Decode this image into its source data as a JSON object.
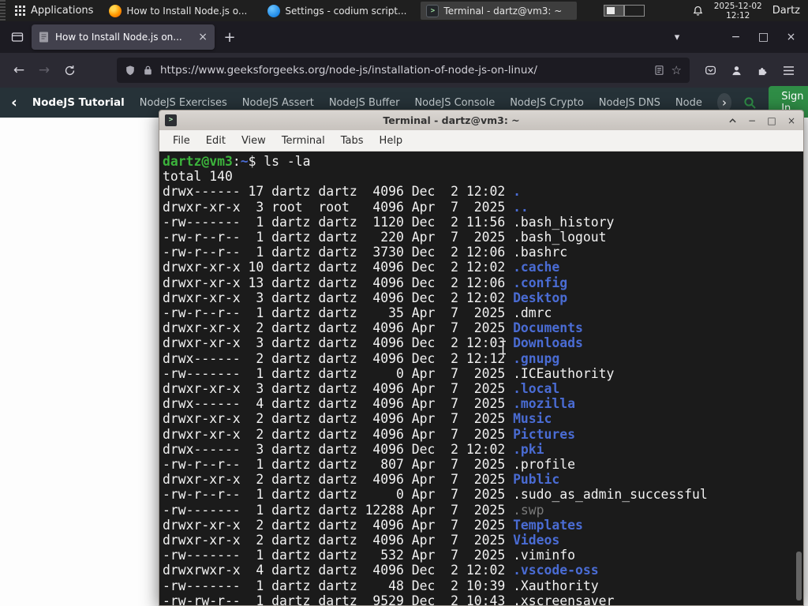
{
  "colors": {
    "prompt_green": "#3cb43c",
    "dir_blue": "#4a6cd4",
    "term_bg": "#1b1b1b",
    "term_fg": "#f2f2f2",
    "dim_file": "#7a7a7a",
    "gfg_green": "#2f8d46"
  },
  "panel": {
    "applications_label": "Applications",
    "tasks": [
      {
        "label": "How to Install Node.js o..."
      },
      {
        "label": "Settings - codium script..."
      },
      {
        "label": "Terminal - dartz@vm3: ~"
      }
    ],
    "date": "2025-12-02",
    "time": "12:12",
    "user": "Dartz"
  },
  "browser": {
    "tab_title": "How to Install Node.js on...",
    "url": "https://www.geeksforgeeks.org/node-js/installation-of-node-js-on-linux/",
    "site_nav": {
      "active_item": "NodeJS Tutorial",
      "items": [
        "NodeJS Exercises",
        "NodeJS Assert",
        "NodeJS Buffer",
        "NodeJS Console",
        "NodeJS Crypto",
        "NodeJS DNS",
        "Node"
      ],
      "sign_in_label": "Sign In"
    }
  },
  "glyphs": {
    "back": "←",
    "forward": "→",
    "new_tab": "+",
    "tab_close": "×",
    "minimize": "−",
    "maximize": "□",
    "close": "×",
    "chevron_down": "▾",
    "star": "☆",
    "prev_chevron": "‹",
    "next_chevron": "›",
    "prompt_gt": ">"
  },
  "terminal": {
    "window_title": "Terminal - dartz@vm3: ~",
    "menu": [
      "File",
      "Edit",
      "View",
      "Terminal",
      "Tabs",
      "Help"
    ],
    "prompt": {
      "user": "dartz@vm3",
      "separator": ":",
      "path": "~",
      "sigil": "$",
      "command": "ls -la"
    },
    "total_line": "total 140",
    "listing": [
      [
        "drwx------",
        17,
        "dartz",
        "dartz",
        4096,
        "Dec",
        2,
        "12:02",
        ".",
        "dir"
      ],
      [
        "drwxr-xr-x",
        3,
        "root",
        "root",
        4096,
        "Apr",
        7,
        "2025",
        "..",
        "dir"
      ],
      [
        "-rw-------",
        1,
        "dartz",
        "dartz",
        1120,
        "Dec",
        2,
        "11:56",
        ".bash_history",
        "file"
      ],
      [
        "-rw-r--r--",
        1,
        "dartz",
        "dartz",
        220,
        "Apr",
        7,
        "2025",
        ".bash_logout",
        "file"
      ],
      [
        "-rw-r--r--",
        1,
        "dartz",
        "dartz",
        3730,
        "Dec",
        2,
        "12:06",
        ".bashrc",
        "file"
      ],
      [
        "drwxr-xr-x",
        10,
        "dartz",
        "dartz",
        4096,
        "Dec",
        2,
        "12:02",
        ".cache",
        "dir"
      ],
      [
        "drwxr-xr-x",
        13,
        "dartz",
        "dartz",
        4096,
        "Dec",
        2,
        "12:06",
        ".config",
        "dir"
      ],
      [
        "drwxr-xr-x",
        3,
        "dartz",
        "dartz",
        4096,
        "Dec",
        2,
        "12:02",
        "Desktop",
        "dir"
      ],
      [
        "-rw-r--r--",
        1,
        "dartz",
        "dartz",
        35,
        "Apr",
        7,
        "2025",
        ".dmrc",
        "file"
      ],
      [
        "drwxr-xr-x",
        2,
        "dartz",
        "dartz",
        4096,
        "Apr",
        7,
        "2025",
        "Documents",
        "dir"
      ],
      [
        "drwxr-xr-x",
        3,
        "dartz",
        "dartz",
        4096,
        "Dec",
        2,
        "12:03",
        "Downloads",
        "dir"
      ],
      [
        "drwx------",
        2,
        "dartz",
        "dartz",
        4096,
        "Dec",
        2,
        "12:12",
        ".gnupg",
        "dir"
      ],
      [
        "-rw-------",
        1,
        "dartz",
        "dartz",
        0,
        "Apr",
        7,
        "2025",
        ".ICEauthority",
        "file"
      ],
      [
        "drwxr-xr-x",
        3,
        "dartz",
        "dartz",
        4096,
        "Apr",
        7,
        "2025",
        ".local",
        "dir"
      ],
      [
        "drwx------",
        4,
        "dartz",
        "dartz",
        4096,
        "Apr",
        7,
        "2025",
        ".mozilla",
        "dir"
      ],
      [
        "drwxr-xr-x",
        2,
        "dartz",
        "dartz",
        4096,
        "Apr",
        7,
        "2025",
        "Music",
        "dir"
      ],
      [
        "drwxr-xr-x",
        2,
        "dartz",
        "dartz",
        4096,
        "Apr",
        7,
        "2025",
        "Pictures",
        "dir"
      ],
      [
        "drwx------",
        3,
        "dartz",
        "dartz",
        4096,
        "Dec",
        2,
        "12:02",
        ".pki",
        "dir"
      ],
      [
        "-rw-r--r--",
        1,
        "dartz",
        "dartz",
        807,
        "Apr",
        7,
        "2025",
        ".profile",
        "file"
      ],
      [
        "drwxr-xr-x",
        2,
        "dartz",
        "dartz",
        4096,
        "Apr",
        7,
        "2025",
        "Public",
        "dir"
      ],
      [
        "-rw-r--r--",
        1,
        "dartz",
        "dartz",
        0,
        "Apr",
        7,
        "2025",
        ".sudo_as_admin_successful",
        "file"
      ],
      [
        "-rw-------",
        1,
        "dartz",
        "dartz",
        12288,
        "Apr",
        7,
        "2025",
        ".swp",
        "dim"
      ],
      [
        "drwxr-xr-x",
        2,
        "dartz",
        "dartz",
        4096,
        "Apr",
        7,
        "2025",
        "Templates",
        "dir"
      ],
      [
        "drwxr-xr-x",
        2,
        "dartz",
        "dartz",
        4096,
        "Apr",
        7,
        "2025",
        "Videos",
        "dir"
      ],
      [
        "-rw-------",
        1,
        "dartz",
        "dartz",
        532,
        "Apr",
        7,
        "2025",
        ".viminfo",
        "file"
      ],
      [
        "drwxrwxr-x",
        4,
        "dartz",
        "dartz",
        4096,
        "Dec",
        2,
        "12:02",
        ".vscode-oss",
        "dir"
      ],
      [
        "-rw-------",
        1,
        "dartz",
        "dartz",
        48,
        "Dec",
        2,
        "10:39",
        ".Xauthority",
        "file"
      ],
      [
        "-rw-rw-r--",
        1,
        "dartz",
        "dartz",
        9529,
        "Dec",
        2,
        "10:43",
        ".xscreensaver",
        "file"
      ]
    ]
  }
}
